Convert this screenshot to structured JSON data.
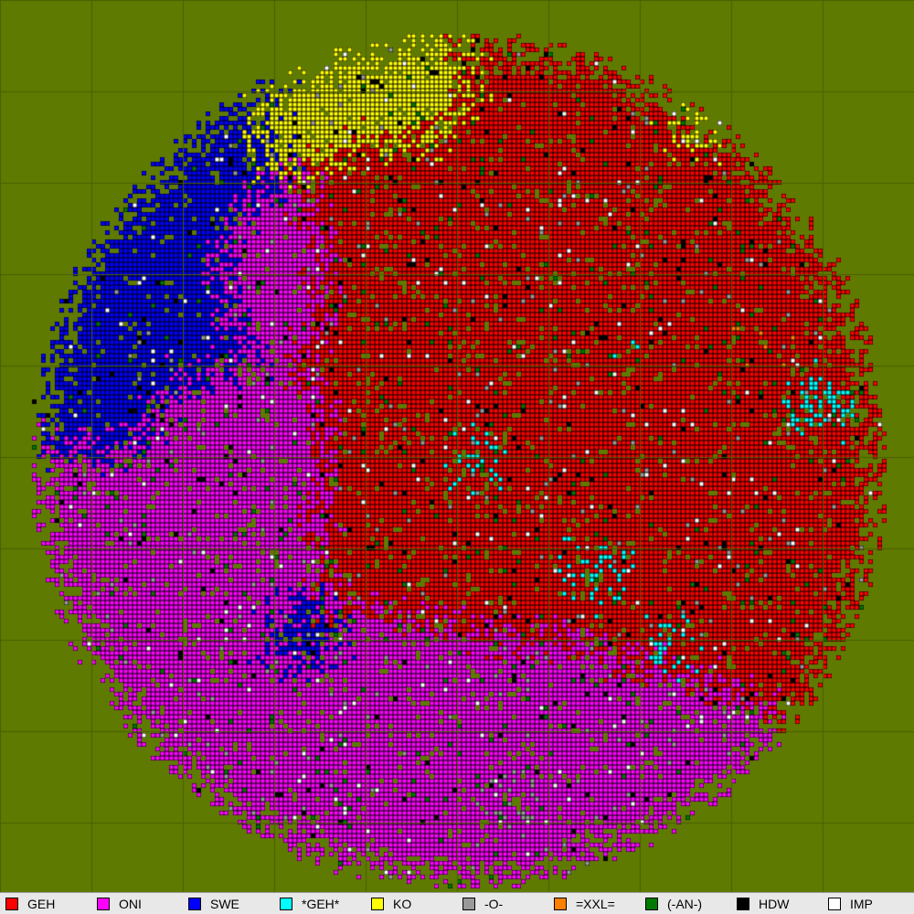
{
  "colors": {
    "background": "#5f7a00",
    "grid": "#4a6000",
    "cell_border": "#000000"
  },
  "map": {
    "grid": true,
    "grid_spacing_cells": 10,
    "disc_shape": "circle"
  },
  "legend": [
    {
      "label": "GEH",
      "color": "#ff0000"
    },
    {
      "label": "ONI",
      "color": "#ff00ff"
    },
    {
      "label": "SWE",
      "color": "#0000ff"
    },
    {
      "label": "*GEH*",
      "color": "#00ffff"
    },
    {
      "label": "KO",
      "color": "#ffff00"
    },
    {
      "label": "-O-",
      "color": "#999999"
    },
    {
      "label": "=XXL=",
      "color": "#ff8000"
    },
    {
      "label": "(-AN-)",
      "color": "#007a00"
    },
    {
      "label": "HDW",
      "color": "#000000"
    },
    {
      "label": "IMP",
      "color": "#ffffff"
    }
  ]
}
